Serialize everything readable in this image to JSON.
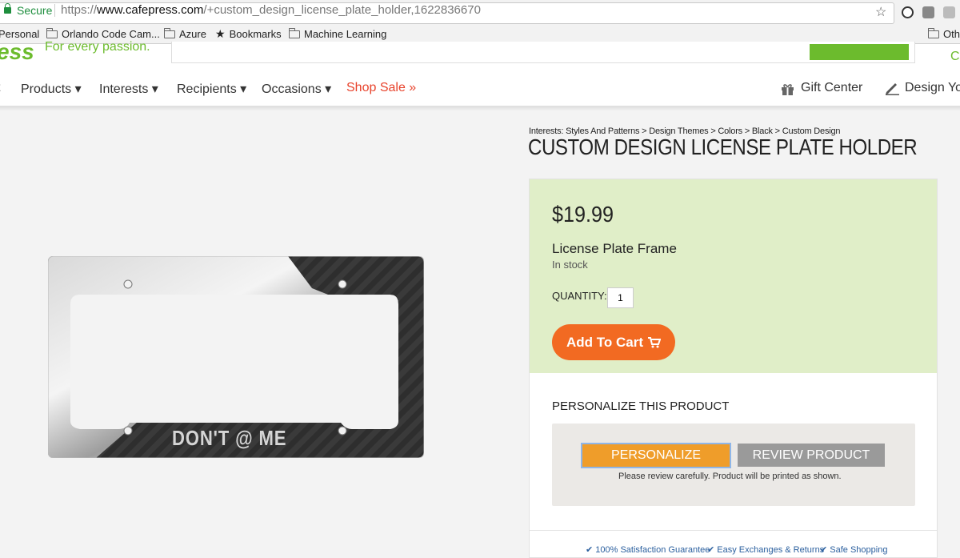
{
  "browser": {
    "secure_label": "Secure",
    "url_scheme": "https://",
    "url_domain": "www.cafepress.com",
    "url_path": "/+custom_design_license_plate_holder,1622836670"
  },
  "bookmarks": [
    {
      "label": "Personal"
    },
    {
      "label": "Orlando Code Cam..."
    },
    {
      "label": "Azure"
    },
    {
      "label": "Bookmarks"
    },
    {
      "label": "Machine Learning"
    },
    {
      "label": "Oth"
    }
  ],
  "header": {
    "logo_text": "ess",
    "tagline": "For every passion.",
    "right_fragment": "C"
  },
  "nav": {
    "items": [
      {
        "label": "Products ▾"
      },
      {
        "label": "Interests ▾"
      },
      {
        "label": "Recipients ▾"
      },
      {
        "label": "Occasions ▾"
      },
      {
        "label": "Shop Sale »"
      }
    ],
    "gift_center": "Gift Center",
    "design_your": "Design You"
  },
  "product": {
    "breadcrumb": "Interests: Styles And Patterns > Design Themes > Colors > Black > Custom Design",
    "title": "CUSTOM DESIGN LICENSE PLATE HOLDER",
    "price": "$19.99",
    "name": "License Plate Frame",
    "stock": "In stock",
    "quantity_label": "QUANTITY:",
    "quantity_value": "1",
    "add_to_cart": "Add To Cart",
    "plate_text": "DON'T @ ME"
  },
  "personalize": {
    "heading": "PERSONALIZE THIS PRODUCT",
    "personalize_button": "PERSONALIZE",
    "review_button": "REVIEW PRODUCT",
    "note": "Please review carefully. Product will be printed as shown."
  },
  "guarantees": [
    {
      "label": "100% Satisfaction Guarantee"
    },
    {
      "label": "Easy Exchanges & Returns"
    },
    {
      "label": "Safe Shopping"
    }
  ],
  "colors": {
    "brand_green": "#6cbb2d",
    "cart_orange": "#f26a22",
    "price_bg": "#e0eec8",
    "sale_red": "#e8432c"
  }
}
